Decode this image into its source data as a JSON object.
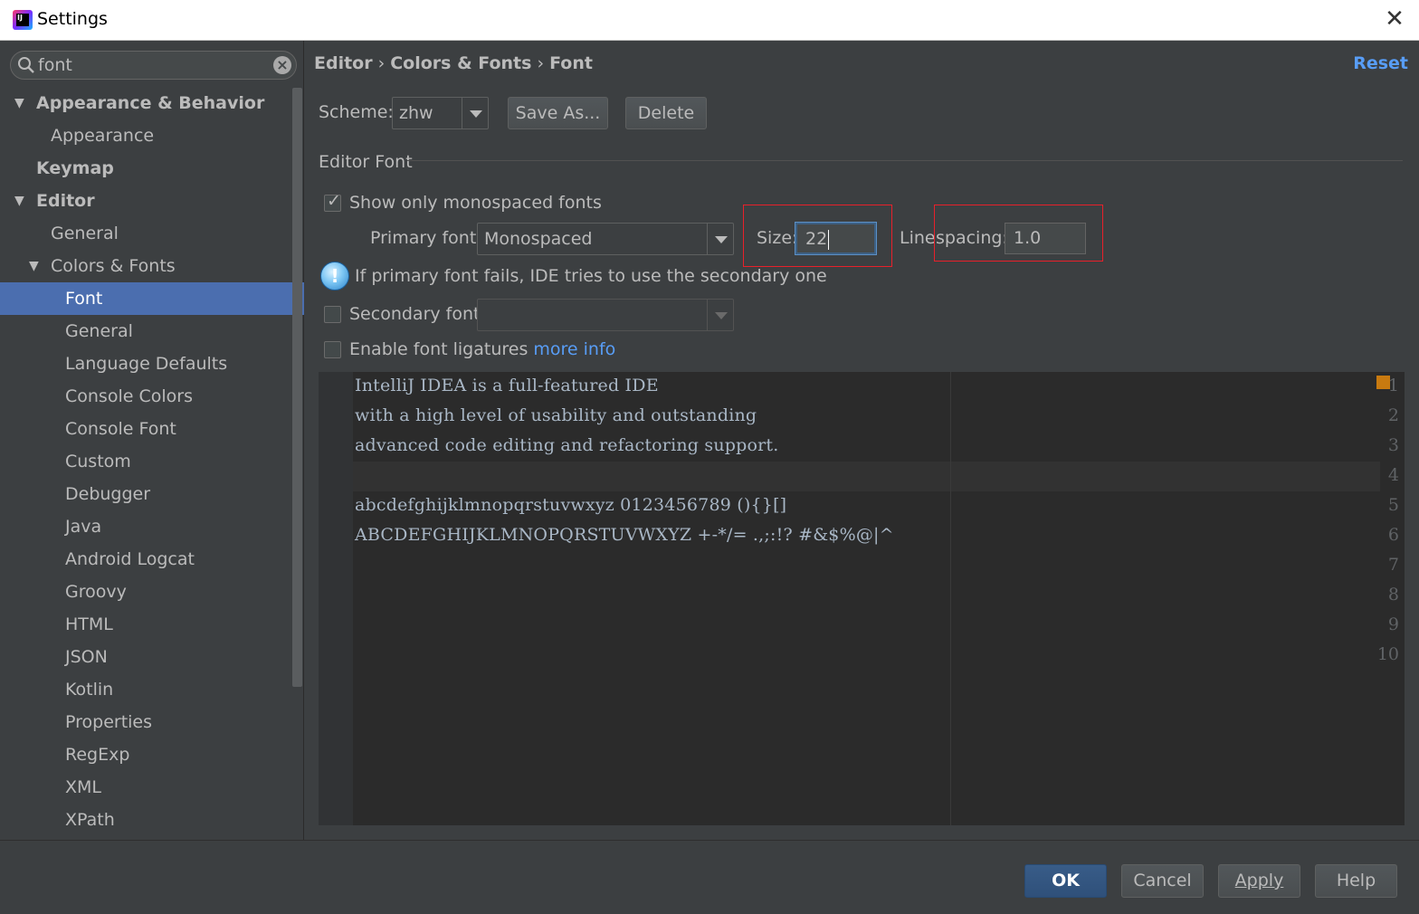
{
  "window": {
    "title": "Settings"
  },
  "search": {
    "value": "font"
  },
  "tree": [
    {
      "label": "Appearance & Behavior",
      "level": 0,
      "bold": true,
      "expanded": true,
      "arrow": true
    },
    {
      "label": "Appearance",
      "level": 1
    },
    {
      "label": "Keymap",
      "level": 0,
      "bold": true
    },
    {
      "label": "Editor",
      "level": 0,
      "bold": true,
      "expanded": true,
      "arrow": true
    },
    {
      "label": "General",
      "level": 1
    },
    {
      "label": "Colors & Fonts",
      "level": 1,
      "expanded": true,
      "arrow": true
    },
    {
      "label": "Font",
      "level": 2,
      "selected": true
    },
    {
      "label": "General",
      "level": 2
    },
    {
      "label": "Language Defaults",
      "level": 2
    },
    {
      "label": "Console Colors",
      "level": 2
    },
    {
      "label": "Console Font",
      "level": 2
    },
    {
      "label": "Custom",
      "level": 2
    },
    {
      "label": "Debugger",
      "level": 2
    },
    {
      "label": "Java",
      "level": 2
    },
    {
      "label": "Android Logcat",
      "level": 2
    },
    {
      "label": "Groovy",
      "level": 2
    },
    {
      "label": "HTML",
      "level": 2
    },
    {
      "label": "JSON",
      "level": 2
    },
    {
      "label": "Kotlin",
      "level": 2
    },
    {
      "label": "Properties",
      "level": 2
    },
    {
      "label": "RegExp",
      "level": 2
    },
    {
      "label": "XML",
      "level": 2
    },
    {
      "label": "XPath",
      "level": 2
    }
  ],
  "breadcrumb": {
    "part1": "Editor",
    "part2": "Colors & Fonts",
    "part3": "Font",
    "sep": "›"
  },
  "reset_label": "Reset",
  "scheme": {
    "label": "Scheme:",
    "value": "zhw",
    "save_as": "Save As...",
    "delete": "Delete"
  },
  "editor_font": {
    "section_title": "Editor Font",
    "mono_label": "Show only monospaced fonts",
    "mono_checked": true,
    "primary_label": "Primary font:",
    "primary_value": "Monospaced",
    "size_label": "Size:",
    "size_value": "22",
    "line_label": "Line",
    "spacing_label": "spacing:",
    "line_spacing_value": "1.0",
    "info_text": "If primary font fails, IDE tries to use the secondary one",
    "secondary_label": "Secondary font:",
    "secondary_value": "",
    "ligatures_label": "Enable font ligatures",
    "ligatures_checked": false,
    "more_info": "more info"
  },
  "preview": {
    "lines": [
      "IntelliJ IDEA is a full-featured IDE",
      "with a high level of usability and outstanding",
      "advanced code editing and refactoring support.",
      "",
      "abcdefghijklmnopqrstuvwxyz 0123456789 (){}[]",
      "ABCDEFGHIJKLMNOPQRSTUVWXYZ +-*/= .,;:!? #&$%@|^",
      "",
      "",
      "",
      ""
    ],
    "line_numbers": [
      "1",
      "2",
      "3",
      "4",
      "5",
      "6",
      "7",
      "8",
      "9",
      "10"
    ]
  },
  "footer": {
    "ok": "OK",
    "cancel": "Cancel",
    "apply": "Apply",
    "help": "Help"
  },
  "colors": {
    "selection": "#4b6eaf",
    "link": "#589df6",
    "highlight_box": "#e8202a",
    "primary_button": "#365880"
  }
}
